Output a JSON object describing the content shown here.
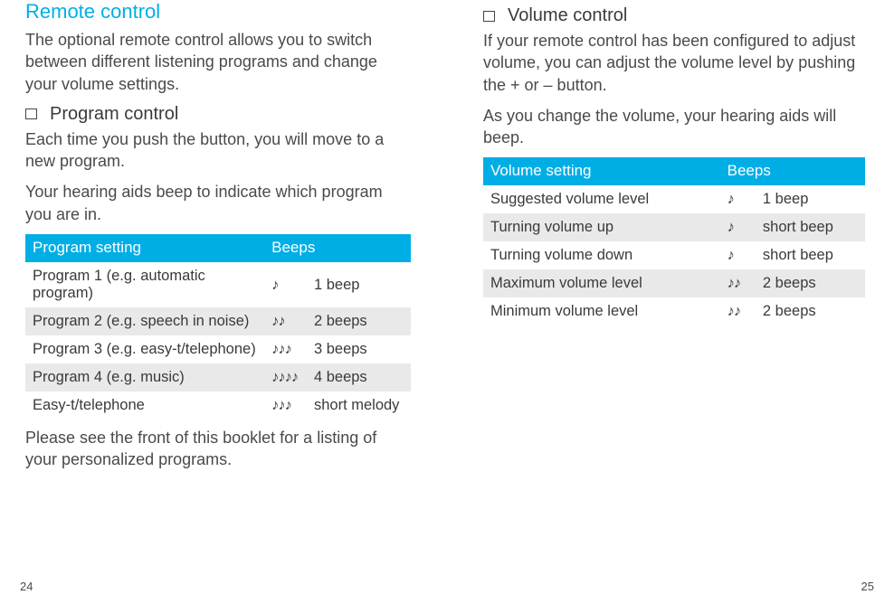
{
  "left": {
    "title": "Remote control",
    "intro": "The optional remote control allows you to switch between different listening programs and change your volume settings.",
    "sub1": "Program control",
    "p1": "Each time you push the button, you will move to a new program.",
    "p2": "Your hearing aids beep to indicate which program you are in.",
    "tableHeader": {
      "col1": "Program setting",
      "col2": "Beeps"
    },
    "rows": [
      {
        "setting": "Program 1 (e.g. automatic program)",
        "notes": "♪",
        "beeps": "1 beep"
      },
      {
        "setting": "Program 2 (e.g. speech in noise)",
        "notes": "♪♪",
        "beeps": "2 beeps"
      },
      {
        "setting": "Program 3 (e.g. easy-t/telephone)",
        "notes": "♪♪♪",
        "beeps": "3 beeps"
      },
      {
        "setting": "Program 4 (e.g. music)",
        "notes": "♪♪♪♪",
        "beeps": "4 beeps"
      },
      {
        "setting": "Easy-t/telephone",
        "notes": "♪♪♪",
        "beeps": "short melody"
      }
    ],
    "footnote": "Please see the front of this booklet for a listing of your personalized programs.",
    "pageNum": "24"
  },
  "right": {
    "sub1": "Volume control",
    "p1": "If your remote control has been configured to adjust volume, you can adjust the volume level by pushing the + or – button.",
    "p2": "As you change the volume, your hearing aids will beep.",
    "tableHeader": {
      "col1": "Volume setting",
      "col2": "Beeps"
    },
    "rows": [
      {
        "setting": "Suggested volume level",
        "notes": "♪",
        "beeps": "1 beep"
      },
      {
        "setting": "Turning volume up",
        "notes": "♪",
        "beeps": "short beep"
      },
      {
        "setting": "Turning volume down",
        "notes": "♪",
        "beeps": "short beep"
      },
      {
        "setting": "Maximum volume level",
        "notes": "♪♪",
        "beeps": "2 beeps"
      },
      {
        "setting": "Minimum volume level",
        "notes": "♪♪",
        "beeps": "2 beeps"
      }
    ],
    "pageNum": "25"
  }
}
